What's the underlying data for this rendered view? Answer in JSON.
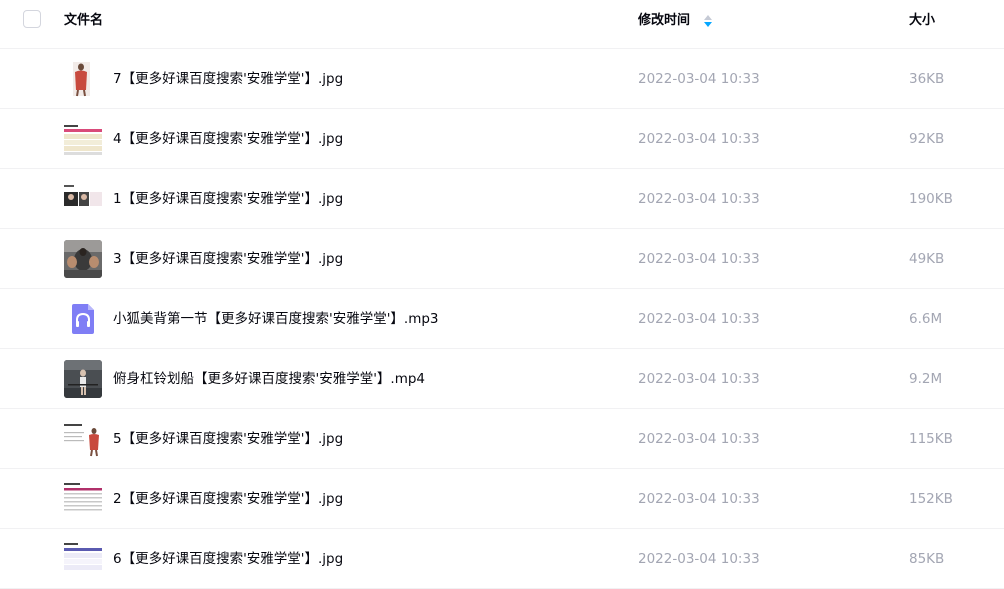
{
  "header": {
    "name_label": "文件名",
    "time_label": "修改时间",
    "size_label": "大小",
    "sort_icon": "sort-icon",
    "accent_color": "#06a7ff"
  },
  "files": [
    {
      "name": "7【更多好课百度搜索'安雅学堂'】.jpg",
      "modified": "2022-03-04 10:33",
      "size": "36KB",
      "icon": "image-thumbnail"
    },
    {
      "name": "4【更多好课百度搜索'安雅学堂'】.jpg",
      "modified": "2022-03-04 10:33",
      "size": "92KB",
      "icon": "image-thumbnail"
    },
    {
      "name": "1【更多好课百度搜索'安雅学堂'】.jpg",
      "modified": "2022-03-04 10:33",
      "size": "190KB",
      "icon": "image-thumbnail"
    },
    {
      "name": "3【更多好课百度搜索'安雅学堂'】.jpg",
      "modified": "2022-03-04 10:33",
      "size": "49KB",
      "icon": "image-thumbnail"
    },
    {
      "name": "小狐美背第一节【更多好课百度搜索'安雅学堂'】.mp3",
      "modified": "2022-03-04 10:33",
      "size": "6.6M",
      "icon": "headphones-icon"
    },
    {
      "name": "俯身杠铃划船【更多好课百度搜索'安雅学堂'】.mp4",
      "modified": "2022-03-04 10:33",
      "size": "9.2M",
      "icon": "video-thumbnail"
    },
    {
      "name": "5【更多好课百度搜索'安雅学堂'】.jpg",
      "modified": "2022-03-04 10:33",
      "size": "115KB",
      "icon": "image-thumbnail"
    },
    {
      "name": "2【更多好课百度搜索'安雅学堂'】.jpg",
      "modified": "2022-03-04 10:33",
      "size": "152KB",
      "icon": "image-thumbnail"
    },
    {
      "name": "6【更多好课百度搜索'安雅学堂'】.jpg",
      "modified": "2022-03-04 10:33",
      "size": "85KB",
      "icon": "image-thumbnail"
    }
  ]
}
